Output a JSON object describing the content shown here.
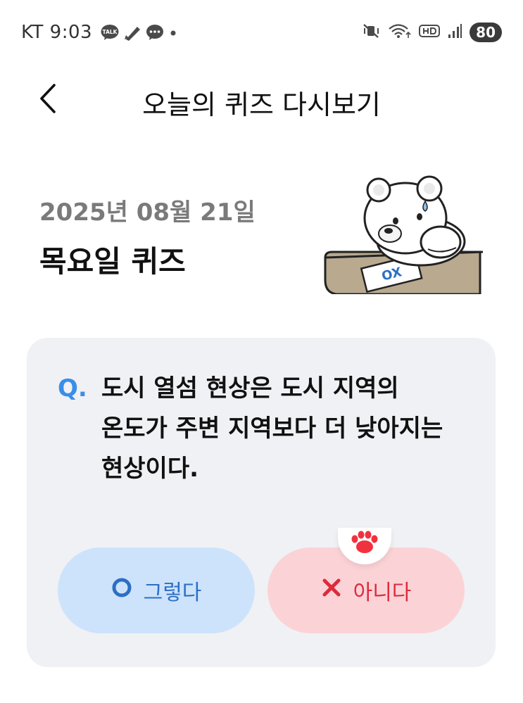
{
  "status_bar": {
    "carrier_time": "KT 9:03",
    "battery": "80",
    "talk_icon_label": "TALK",
    "notifications": [
      "talk-icon",
      "pen-icon",
      "chat-icon",
      "dot-icon"
    ],
    "system_icons": [
      "mute-vibrate-icon",
      "wifi-icon",
      "hd-icon",
      "signal-icon"
    ]
  },
  "header": {
    "back_icon": "chevron-left-icon",
    "title": "오늘의 퀴즈 다시보기"
  },
  "quiz_info": {
    "date": "2025년 08월 21일",
    "day_title": "목요일 퀴즈",
    "illustration": "bear-ox-sheet-illustration",
    "sheet_text": "OX"
  },
  "question": {
    "prefix": "Q.",
    "text": "도시 열섬 현상은 도시 지역의\n온도가 주변 지역보다 더 낮아지는\n현상이다."
  },
  "answers": {
    "yes": {
      "icon": "circle-o-icon",
      "label": "그렇다"
    },
    "no": {
      "icon": "x-mark-icon",
      "label": "아니다"
    }
  },
  "badge": {
    "icon": "paw-icon"
  },
  "colors": {
    "accent_blue": "#3a8ee8",
    "yes_bg": "#cde3fb",
    "no_bg": "#fbd3d7",
    "no_text": "#dc2c3c",
    "card_bg": "#f0f1f4"
  }
}
